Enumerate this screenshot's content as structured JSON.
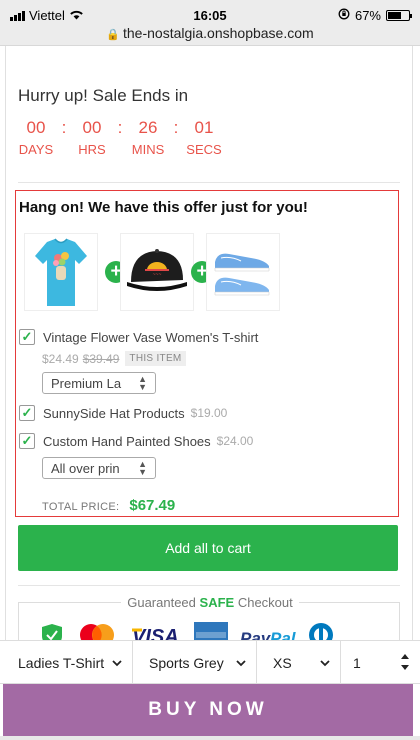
{
  "status_bar": {
    "carrier": "Viettel",
    "time": "16:05",
    "battery": "67%",
    "battery_level": 0.67,
    "url": "the-nostalgia.onshopbase.com"
  },
  "countdown": {
    "heading": "Hurry up! Sale Ends in",
    "units": [
      {
        "value": "00",
        "label": "DAYS"
      },
      {
        "value": "00",
        "label": "HRS"
      },
      {
        "value": "26",
        "label": "MINS"
      },
      {
        "value": "01",
        "label": "SECS"
      }
    ],
    "separator": ":",
    "color": "#e8534a"
  },
  "offer": {
    "title": "Hang on! We have this offer just for you!",
    "border_color": "#e43a3a",
    "products": [
      {
        "name": "Vintage Flower Vase Women's T-shirt",
        "price": "$24.49",
        "compare_price": "$39.49",
        "badge": "THIS ITEM",
        "checked": true,
        "variant": "Premium La",
        "thumbnail_icon": "tshirt-image"
      },
      {
        "name": "SunnySide Hat Products",
        "price": "$19.00",
        "checked": true,
        "thumbnail_icon": "hat-image"
      },
      {
        "name": "Custom Hand Painted Shoes",
        "price": "$24.00",
        "checked": true,
        "variant": "All over prin",
        "thumbnail_icon": "shoes-image"
      }
    ],
    "total_label": "TOTAL PRICE:",
    "total_value": "$67.49",
    "accent_color": "#2bb24c"
  },
  "add_all_button": "Add all to cart",
  "secure_checkout": {
    "prefix": "Guaranteed",
    "highlight": "SAFE",
    "suffix": "Checkout",
    "logos": [
      "shield-icon",
      "mastercard-logo",
      "visa-logo",
      "amex-logo",
      "paypal-logo",
      "diners-logo"
    ]
  },
  "sticky_bar": {
    "style_select": "Ladies T-Shirt",
    "color_select": "Sports Grey",
    "size_select": "XS",
    "quantity": "1",
    "buy_now": "BUY NOW",
    "buy_color": "#a36aa4"
  }
}
